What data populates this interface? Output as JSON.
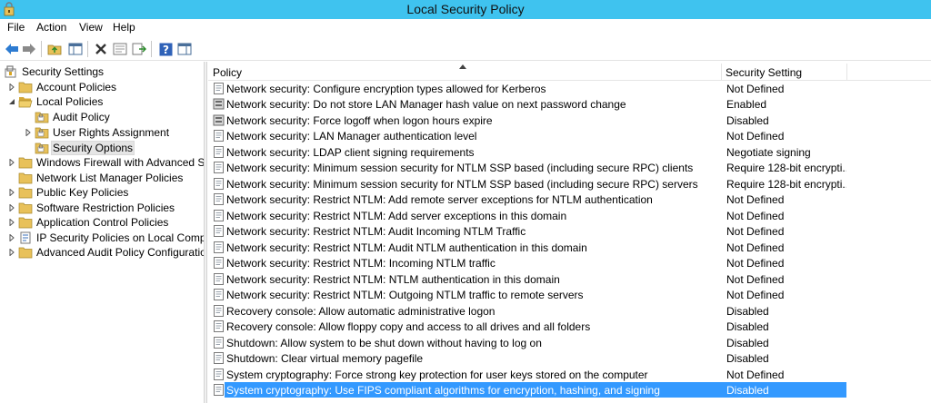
{
  "window": {
    "title": "Local Security Policy"
  },
  "menu": [
    "File",
    "Action",
    "View",
    "Help"
  ],
  "toolbar": {
    "buttons": [
      "back-arrow-icon",
      "forward-arrow-icon",
      "up-folder-icon",
      "show-hide-tree-icon",
      "delete-icon",
      "properties-icon",
      "export-list-icon",
      "help-icon",
      "action-pane-icon"
    ]
  },
  "tree": [
    {
      "label": "Security Settings",
      "level": 0,
      "expander": "",
      "icon": "security-settings-icon"
    },
    {
      "label": "Account Policies",
      "level": 1,
      "expander": "collapsed",
      "icon": "folder-icon"
    },
    {
      "label": "Local Policies",
      "level": 1,
      "expander": "expanded",
      "icon": "folder-open-icon"
    },
    {
      "label": "Audit Policy",
      "level": 2,
      "expander": "",
      "icon": "policy-folder-icon"
    },
    {
      "label": "User Rights Assignment",
      "level": 2,
      "expander": "collapsed",
      "icon": "policy-folder-icon"
    },
    {
      "label": "Security Options",
      "level": 2,
      "expander": "",
      "icon": "policy-folder-icon",
      "selected": true
    },
    {
      "label": "Windows Firewall with Advanced Secu",
      "level": 1,
      "expander": "collapsed",
      "icon": "folder-icon"
    },
    {
      "label": "Network List Manager Policies",
      "level": 1,
      "expander": "",
      "icon": "folder-icon"
    },
    {
      "label": "Public Key Policies",
      "level": 1,
      "expander": "collapsed",
      "icon": "folder-icon"
    },
    {
      "label": "Software Restriction Policies",
      "level": 1,
      "expander": "collapsed",
      "icon": "folder-icon"
    },
    {
      "label": "Application Control Policies",
      "level": 1,
      "expander": "collapsed",
      "icon": "folder-icon"
    },
    {
      "label": "IP Security Policies on Local Compute",
      "level": 1,
      "expander": "collapsed",
      "icon": "ip-security-icon"
    },
    {
      "label": "Advanced Audit Policy Configuration",
      "level": 1,
      "expander": "collapsed",
      "icon": "folder-icon"
    }
  ],
  "list": {
    "columns": {
      "policy": "Policy",
      "setting": "Security Setting"
    },
    "rows": [
      {
        "policy": "Network security: Configure encryption types allowed for Kerberos",
        "setting": "Not Defined",
        "icon": "policy-item-icon"
      },
      {
        "policy": "Network security: Do not store LAN Manager hash value on next password change",
        "setting": "Enabled",
        "icon": "policy-server-icon"
      },
      {
        "policy": "Network security: Force logoff when logon hours expire",
        "setting": "Disabled",
        "icon": "policy-server-icon"
      },
      {
        "policy": "Network security: LAN Manager authentication level",
        "setting": "Not Defined",
        "icon": "policy-item-icon"
      },
      {
        "policy": "Network security: LDAP client signing requirements",
        "setting": "Negotiate signing",
        "icon": "policy-item-icon"
      },
      {
        "policy": "Network security: Minimum session security for NTLM SSP based (including secure RPC) clients",
        "setting": "Require 128-bit encrypti...",
        "icon": "policy-item-icon"
      },
      {
        "policy": "Network security: Minimum session security for NTLM SSP based (including secure RPC) servers",
        "setting": "Require 128-bit encrypti...",
        "icon": "policy-item-icon"
      },
      {
        "policy": "Network security: Restrict NTLM: Add remote server exceptions for NTLM authentication",
        "setting": "Not Defined",
        "icon": "policy-item-icon"
      },
      {
        "policy": "Network security: Restrict NTLM: Add server exceptions in this domain",
        "setting": "Not Defined",
        "icon": "policy-item-icon"
      },
      {
        "policy": "Network security: Restrict NTLM: Audit Incoming NTLM Traffic",
        "setting": "Not Defined",
        "icon": "policy-item-icon"
      },
      {
        "policy": "Network security: Restrict NTLM: Audit NTLM authentication in this domain",
        "setting": "Not Defined",
        "icon": "policy-item-icon"
      },
      {
        "policy": "Network security: Restrict NTLM: Incoming NTLM traffic",
        "setting": "Not Defined",
        "icon": "policy-item-icon"
      },
      {
        "policy": "Network security: Restrict NTLM: NTLM authentication in this domain",
        "setting": "Not Defined",
        "icon": "policy-item-icon"
      },
      {
        "policy": "Network security: Restrict NTLM: Outgoing NTLM traffic to remote servers",
        "setting": "Not Defined",
        "icon": "policy-item-icon"
      },
      {
        "policy": "Recovery console: Allow automatic administrative logon",
        "setting": "Disabled",
        "icon": "policy-item-icon"
      },
      {
        "policy": "Recovery console: Allow floppy copy and access to all drives and all folders",
        "setting": "Disabled",
        "icon": "policy-item-icon"
      },
      {
        "policy": "Shutdown: Allow system to be shut down without having to log on",
        "setting": "Disabled",
        "icon": "policy-item-icon"
      },
      {
        "policy": "Shutdown: Clear virtual memory pagefile",
        "setting": "Disabled",
        "icon": "policy-item-icon"
      },
      {
        "policy": "System cryptography: Force strong key protection for user keys stored on the computer",
        "setting": "Not Defined",
        "icon": "policy-item-icon"
      },
      {
        "policy": "System cryptography: Use FIPS compliant algorithms for encryption, hashing, and signing",
        "setting": "Disabled",
        "icon": "policy-item-icon",
        "selected": true
      }
    ]
  },
  "colors": {
    "titlebar": "#3fc3ef",
    "selection": "#3399ff",
    "tree_selection": "#e5e5e5"
  }
}
